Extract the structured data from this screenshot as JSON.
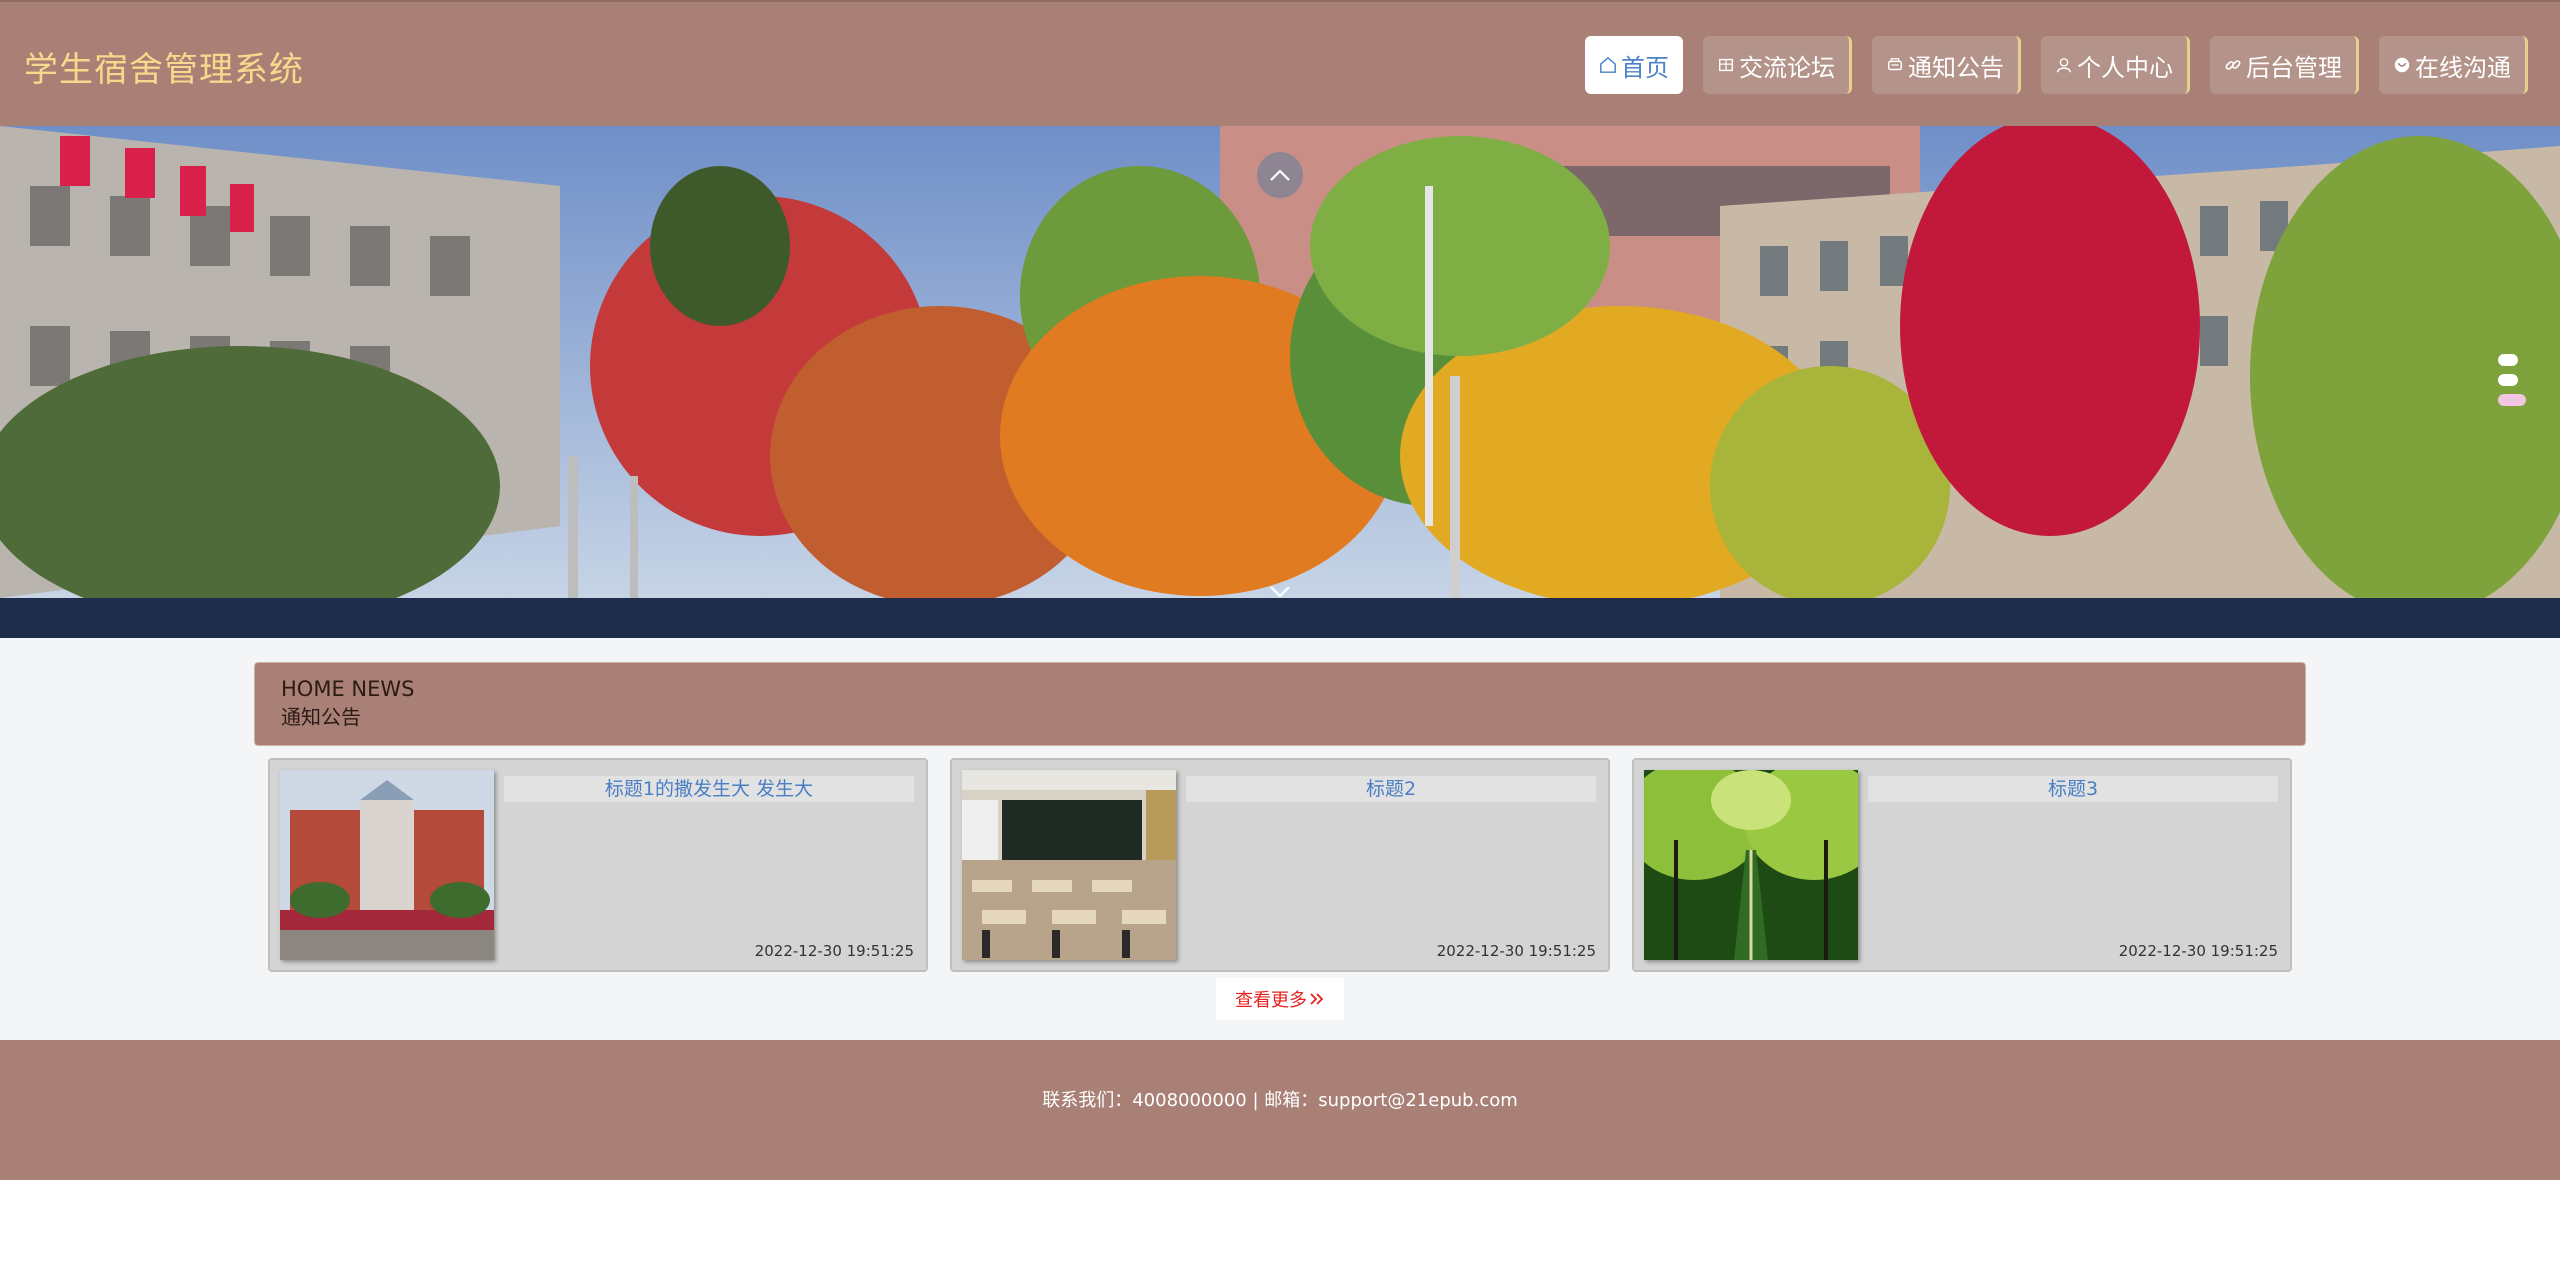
{
  "app": {
    "title": "学生宿舍管理系统"
  },
  "nav": {
    "items": [
      {
        "label": "首页",
        "icon": "home-icon",
        "active": true
      },
      {
        "label": "交流论坛",
        "icon": "forum-icon",
        "active": false
      },
      {
        "label": "通知公告",
        "icon": "notice-icon",
        "active": false
      },
      {
        "label": "个人中心",
        "icon": "user-icon",
        "active": false
      },
      {
        "label": "后台管理",
        "icon": "link-icon",
        "active": false
      },
      {
        "label": "在线沟通",
        "icon": "chat-icon",
        "active": false
      }
    ]
  },
  "banner": {
    "image": "campus autumn trees and buildings",
    "slides_total": 3,
    "active_slide": 3
  },
  "news": {
    "heading_en": "HOME NEWS",
    "heading_cn": "通知公告",
    "cards": [
      {
        "title": "标题1的撒发生大 发生大",
        "time": "2022-12-30 19:51:25",
        "thumb": "campus-building-photo"
      },
      {
        "title": "标题2",
        "time": "2022-12-30 19:51:25",
        "thumb": "classroom-photo"
      },
      {
        "title": "标题3",
        "time": "2022-12-30 19:51:25",
        "thumb": "tree-lined-road-photo"
      }
    ],
    "more_label": "查看更多"
  },
  "footer": {
    "contact": "联系我们：4008000000 | 邮箱：support@21epub.com"
  },
  "colors": {
    "header_bg": "#a98075",
    "logo": "#f6d98c",
    "nav_accent": "#e8cf8f",
    "active_text": "#4b82c8",
    "link_blue": "#4a7fc5",
    "more_red": "#e62222"
  }
}
